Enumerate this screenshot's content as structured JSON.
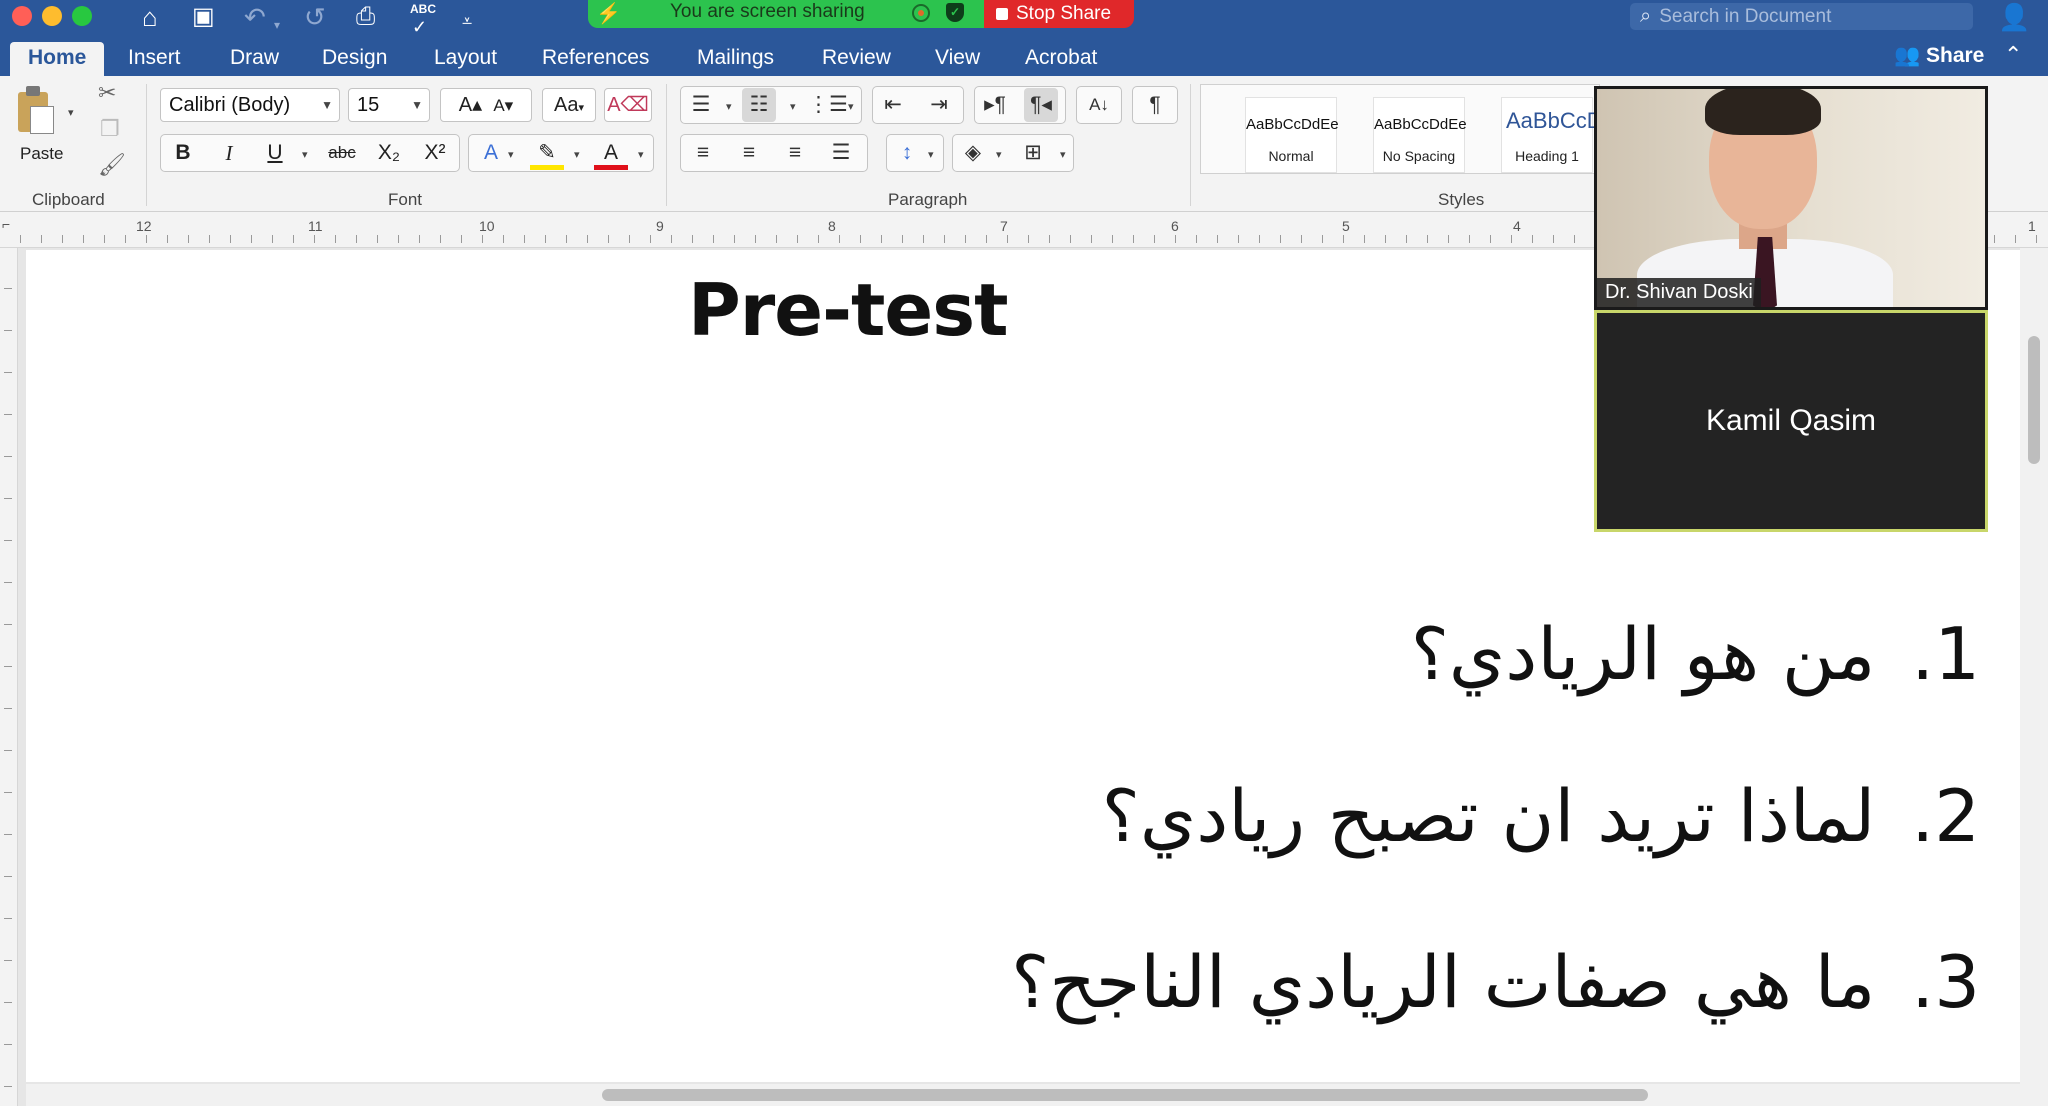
{
  "titlebar": {
    "abc_label": "ABC",
    "screen_sharing_text": "You are screen sharing",
    "stop_share_label": "Stop Share",
    "search_placeholder": "Search in Document"
  },
  "tabs": [
    "Home",
    "Insert",
    "Draw",
    "Design",
    "Layout",
    "References",
    "Mailings",
    "Review",
    "View",
    "Acrobat"
  ],
  "active_tab": "Home",
  "share_label": "Share",
  "ribbon": {
    "paste_label": "Paste",
    "clipboard_label": "Clipboard",
    "font_name": "Calibri (Body)",
    "font_size": "15",
    "font_label": "Font",
    "paragraph_label": "Paragraph",
    "styles_label": "Styles",
    "styles": [
      {
        "sample": "AaBbCcDdEe",
        "name": "Normal"
      },
      {
        "sample": "AaBbCcDdEe",
        "name": "No Spacing"
      },
      {
        "sample": "AaBbCcDc",
        "name": "Heading 1"
      }
    ],
    "font_buttons": {
      "bold": "B",
      "italic": "I",
      "underline": "U",
      "strike": "abc",
      "sub": "X₂",
      "sup": "X²"
    }
  },
  "ruler_numbers": [
    "12",
    "11",
    "10",
    "9",
    "8",
    "7",
    "6",
    "5",
    "4",
    "1"
  ],
  "document": {
    "title": "Pre-test",
    "questions": [
      {
        "num": "1.",
        "text": "من هو الريادي؟"
      },
      {
        "num": "2.",
        "text": "لماذا تريد ان تصبح ريادي؟"
      },
      {
        "num": "3.",
        "text": "ما هي صفات الريادي الناجح؟"
      }
    ]
  },
  "participants": [
    {
      "name": "Dr. Shivan Doski",
      "video": true
    },
    {
      "name": "Kamil Qasim",
      "video": false
    }
  ],
  "colors": {
    "word_blue": "#2b579a",
    "share_green": "#2cc34e",
    "stop_red": "#e0282a"
  }
}
